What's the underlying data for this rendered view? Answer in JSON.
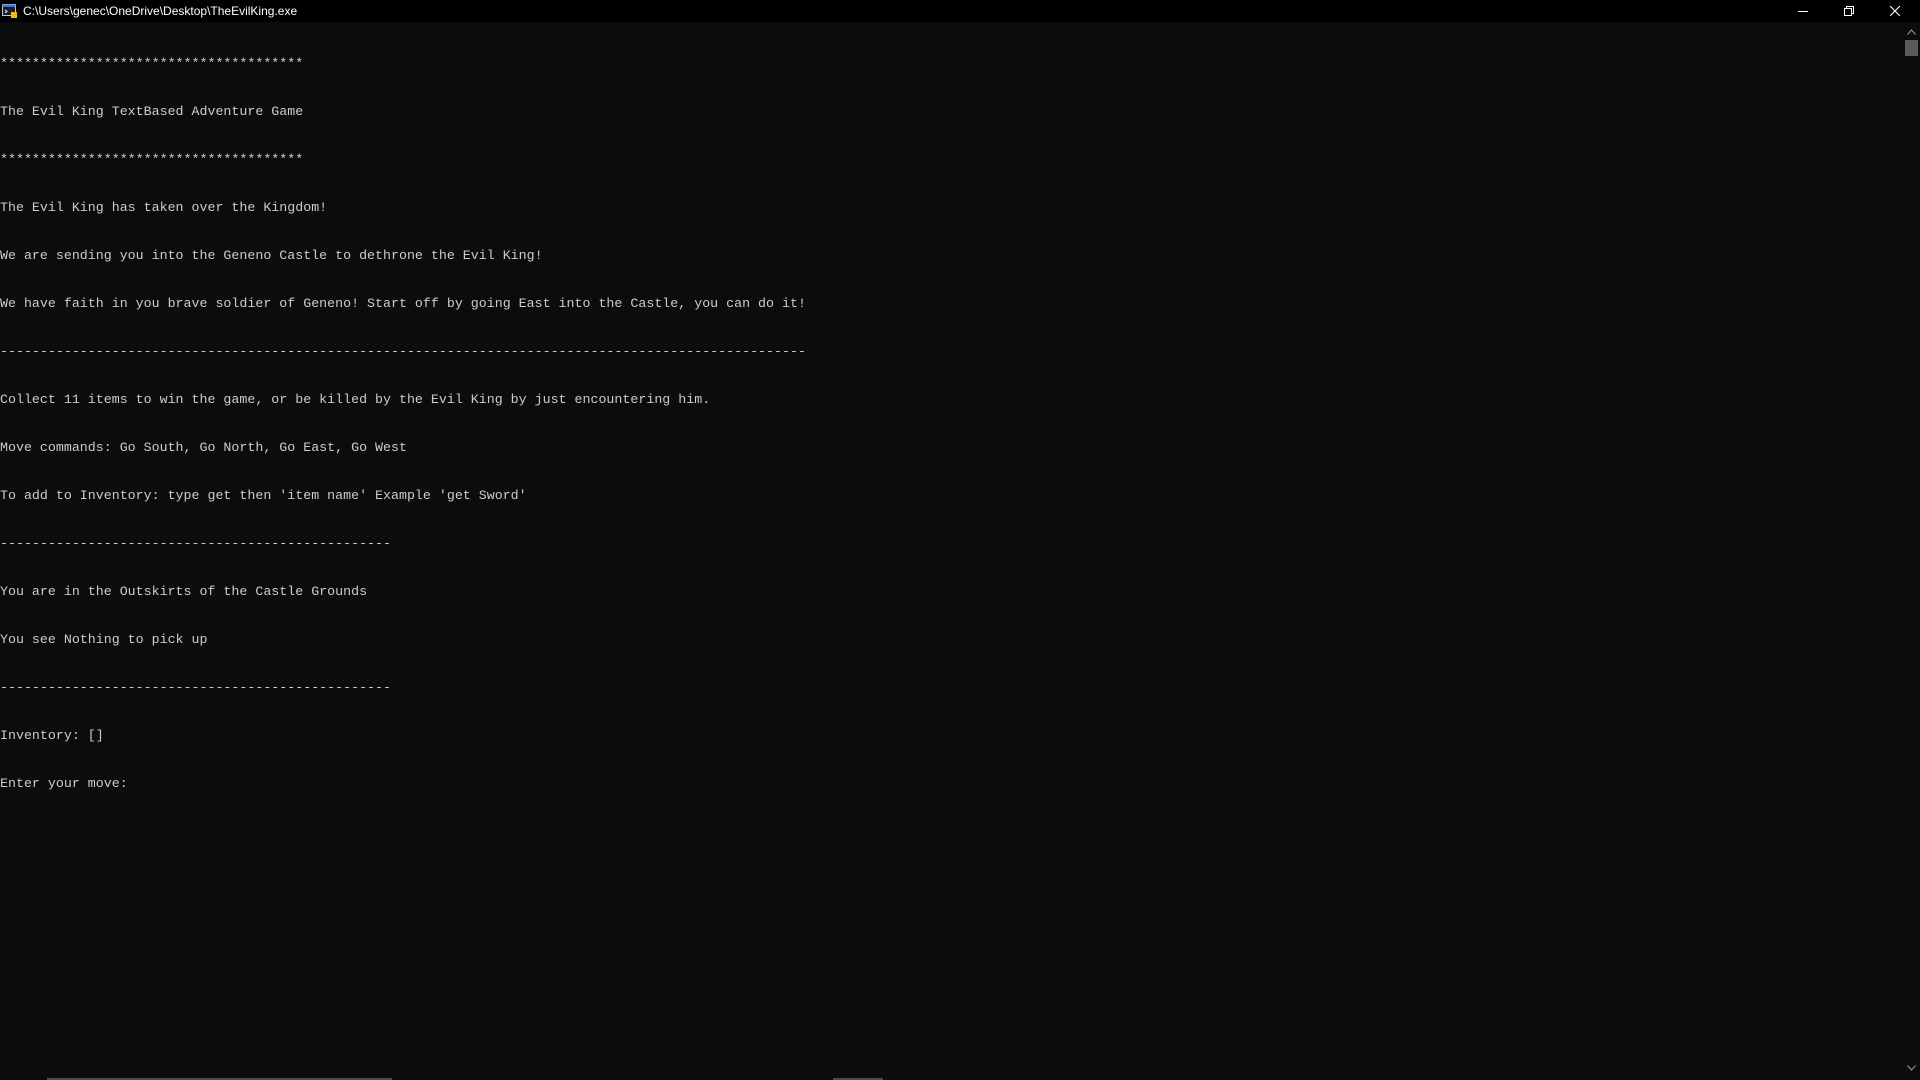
{
  "window": {
    "title": "C:\\Users\\genec\\OneDrive\\Desktop\\TheEvilKing.exe",
    "icon": "console-app-icon"
  },
  "controls": {
    "minimize_icon": "minimize-icon",
    "restore_icon": "restore-icon",
    "close_icon": "close-icon"
  },
  "console": {
    "lines": [
      "**************************************",
      "The Evil King TextBased Adventure Game",
      "**************************************",
      "The Evil King has taken over the Kingdom!",
      "We are sending you into the Geneno Castle to dethrone the Evil King!",
      "We have faith in you brave soldier of Geneno! Start off by going East into the Castle, you can do it!",
      "-----------------------------------------------------------------------------------------------------",
      "Collect 11 items to win the game, or be killed by the Evil King by just encountering him.",
      "Move commands: Go South, Go North, Go East, Go West",
      "To add to Inventory: type get then 'item name' Example 'get Sword'",
      "-------------------------------------------------",
      "You are in the Outskirts of the Castle Grounds",
      "You see Nothing to pick up",
      "-------------------------------------------------",
      "Inventory: []",
      "Enter your move: "
    ]
  },
  "scrollbar": {
    "up_icon": "scroll-up-arrow-icon",
    "down_icon": "scroll-down-arrow-icon"
  },
  "colors": {
    "background": "#0c0c0c",
    "text": "#cccccc",
    "titlebar": "#000000"
  }
}
